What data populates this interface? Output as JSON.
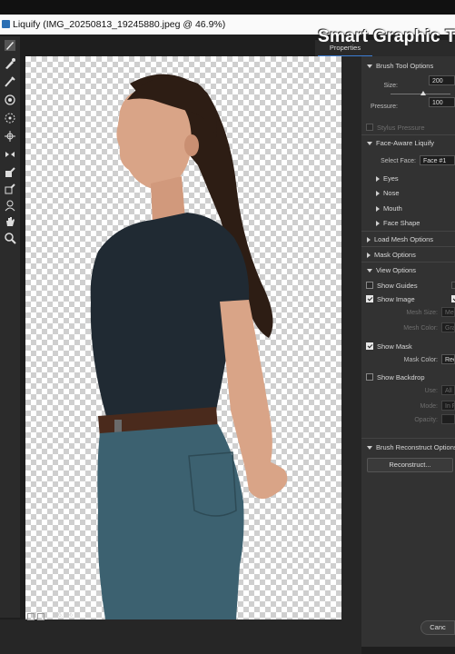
{
  "window": {
    "title": "Liquify (IMG_20250813_19245880.jpeg @ 46.9%)"
  },
  "overlay_text": "Smart Graphic T",
  "panel": {
    "tab": "Properties",
    "brush_tool_options": {
      "header": "Brush Tool Options",
      "size_label": "Size:",
      "size_value": "200",
      "size_fraction": 0.55,
      "pressure_label": "Pressure:",
      "pressure_value": "100",
      "stylus_pressure": "Stylus Pressure"
    },
    "face_aware": {
      "header": "Face-Aware Liquify",
      "select_face_label": "Select Face:",
      "select_face_value": "Face #1",
      "eyes": "Eyes",
      "nose": "Nose",
      "mouth": "Mouth",
      "face_shape": "Face Shape"
    },
    "load_mesh_options": "Load Mesh Options",
    "mask_options": "Mask Options",
    "view_options": {
      "header": "View Options",
      "show_guides": "Show Guides",
      "show_image": "Show Image",
      "mesh_size_label": "Mesh Size:",
      "mesh_size_value": "Me",
      "mesh_color_label": "Mesh Color:",
      "mesh_color_value": "Gra",
      "show_mask": "Show Mask",
      "mask_color_label": "Mask Color:",
      "mask_color_value": "Red",
      "show_backdrop": "Show Backdrop",
      "use_label": "Use:",
      "use_value": "All",
      "mode_label": "Mode:",
      "mode_value": "In F",
      "opacity_label": "Opacity:"
    },
    "brush_reconstruct": {
      "header": "Brush Reconstruct Options",
      "reconstruct_button": "Reconstruct..."
    },
    "cancel_button": "Canc"
  },
  "status": {
    "zoom": "46.9%",
    "zoom_dropdown": "⌄"
  },
  "colors": {
    "accent": "#3c7ed6",
    "tshirt": "#202a33",
    "jeans": "#3c6170",
    "hair": "#2d1d14",
    "skin": "#d9a487"
  }
}
